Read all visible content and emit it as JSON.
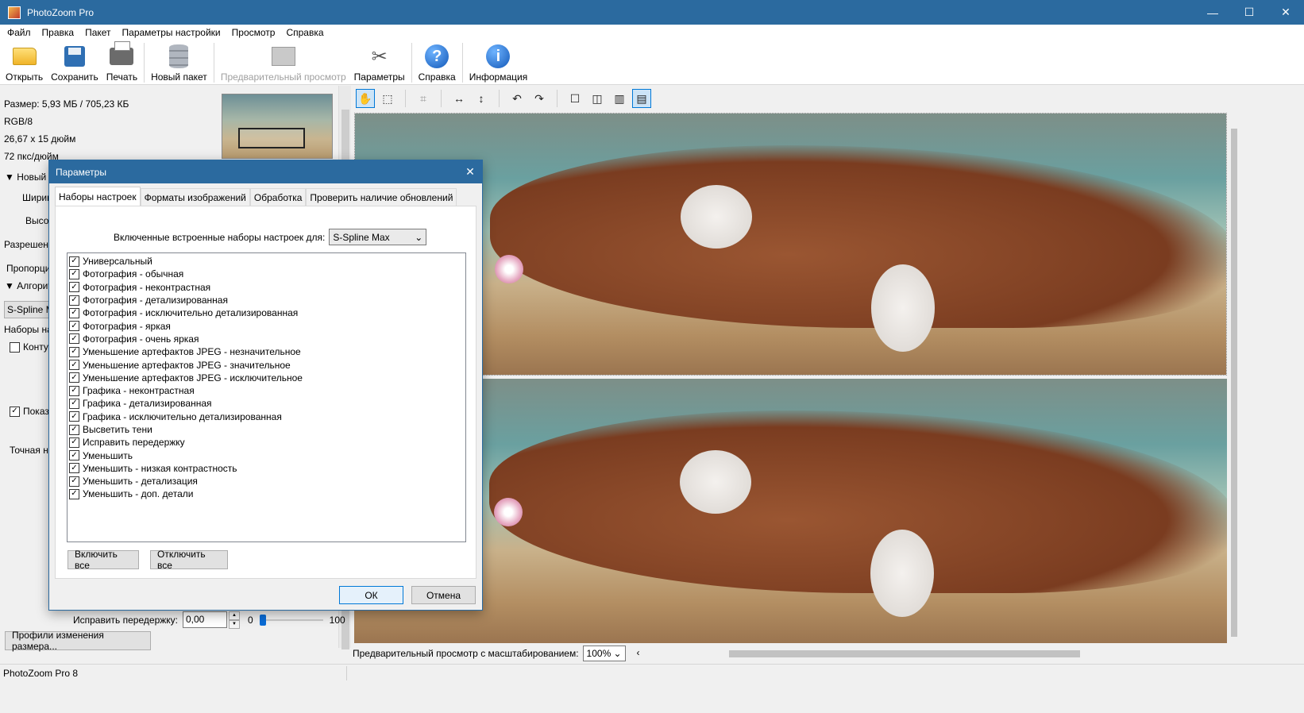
{
  "window": {
    "title": "PhotoZoom Pro",
    "minimize": "—",
    "maximize": "☐",
    "close": "✕"
  },
  "menu": [
    "Файл",
    "Правка",
    "Пакет",
    "Параметры настройки",
    "Просмотр",
    "Справка"
  ],
  "toolbar": {
    "open": "Открыть",
    "save": "Сохранить",
    "print": "Печать",
    "new_batch": "Новый пакет",
    "preview": "Предварительный просмотр",
    "settings": "Параметры",
    "help": "Справка",
    "info": "Информация"
  },
  "left_panel": {
    "size": "Размер: 5,93 МБ / 705,23 КБ",
    "color": "RGB/8",
    "dimensions": "26,67 x 15 дюйм",
    "resolution": "72 пкс/дюйм",
    "new_size_header": "▼ Новый р",
    "width_label": "Ширин",
    "height_label": "Высот",
    "resolution_label": "Разрешени",
    "proportion_label": "Пропорци",
    "algorithm_header": "▼ Алгорит",
    "algorithm_value": "S-Spline M",
    "presets_label": "Наборы на",
    "contour_label": "Контур",
    "show_label": "Показ",
    "fine_label": "Точная н",
    "fix_exposure_label": "Исправить передержку:",
    "fix_exposure_value": "0,00",
    "slider_min": "0",
    "slider_max": "100",
    "slider_value": 0,
    "profiles_button": "Профили изменения размера..."
  },
  "preview": {
    "zoom_label": "Предварительный просмотр с масштабированием:",
    "zoom_value": "100%"
  },
  "status": {
    "text": "PhotoZoom Pro 8"
  },
  "dialog": {
    "title": "Параметры",
    "tabs": [
      "Наборы настроек",
      "Форматы изображений",
      "Обработка",
      "Проверить наличие обновлений"
    ],
    "preset_label": "Включенные встроенные наборы настроек для:",
    "preset_value": "S-Spline Max",
    "items": [
      "Универсальный",
      "Фотография - обычная",
      "Фотография - неконтрастная",
      "Фотография - детализированная",
      "Фотография - исключительно детализированная",
      "Фотография - яркая",
      "Фотография - очень яркая",
      "Уменьшение артефактов JPEG - незначительное",
      "Уменьшение артефактов JPEG - значительное",
      "Уменьшение артефактов JPEG - исключительное",
      "Графика - неконтрастная",
      "Графика - детализированная",
      "Графика - исключительно детализированная",
      "Высветить тени",
      "Исправить передержку",
      "Уменьшить",
      "Уменьшить - низкая контрастность",
      "Уменьшить - детализация",
      "Уменьшить - доп. детали"
    ],
    "enable_all": "Включить все",
    "disable_all": "Отключить все",
    "ok": "ОК",
    "cancel": "Отмена"
  },
  "colors": {
    "titlebar": "#2b6a9f",
    "accent": "#0078d7"
  }
}
